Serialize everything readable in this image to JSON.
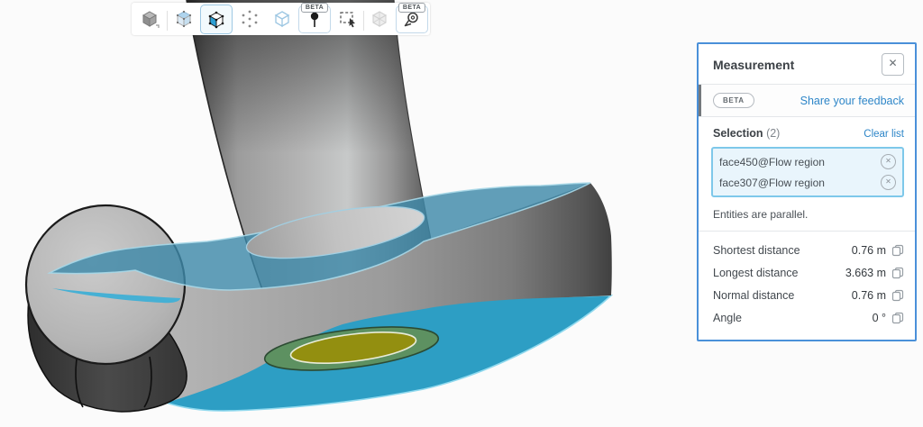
{
  "toolbar": {
    "beta_label": "BETA",
    "items": [
      {
        "name": "view-solid-cube"
      },
      {
        "name": "view-shaded-cube"
      },
      {
        "name": "view-selected-cube"
      },
      {
        "name": "view-vertices"
      },
      {
        "name": "view-wireframe-cube"
      },
      {
        "name": "probe-point"
      },
      {
        "name": "box-select"
      },
      {
        "name": "view-hidden-cube"
      },
      {
        "name": "measure-tape"
      }
    ]
  },
  "panel": {
    "title": "Measurement",
    "close_label": "✕",
    "beta_badge": "BETA",
    "feedback_link": "Share your feedback",
    "selection": {
      "label": "Selection",
      "count": "(2)",
      "clear_label": "Clear list",
      "items": [
        {
          "label": "face450@Flow region",
          "remove_label": "✕"
        },
        {
          "label": "face307@Flow region",
          "remove_label": "✕"
        }
      ]
    },
    "status": "Entities are parallel.",
    "metrics": [
      {
        "label": "Shortest distance",
        "value": "0.76 m"
      },
      {
        "label": "Longest distance",
        "value": "3.663 m"
      },
      {
        "label": "Normal distance",
        "value": "0.76 m"
      },
      {
        "label": "Angle",
        "value": "0 °"
      }
    ]
  },
  "colors": {
    "panel_border": "#4a90d9",
    "link_blue": "#2e86c8",
    "selection_fill": "#e9f5fc",
    "selection_border": "#7ec8ea",
    "face_top_teal": "#3e89a8",
    "face_bottom_cyan": "#2d9ec4",
    "ring_green": "#5d9161",
    "ring_olive": "#938f10"
  }
}
